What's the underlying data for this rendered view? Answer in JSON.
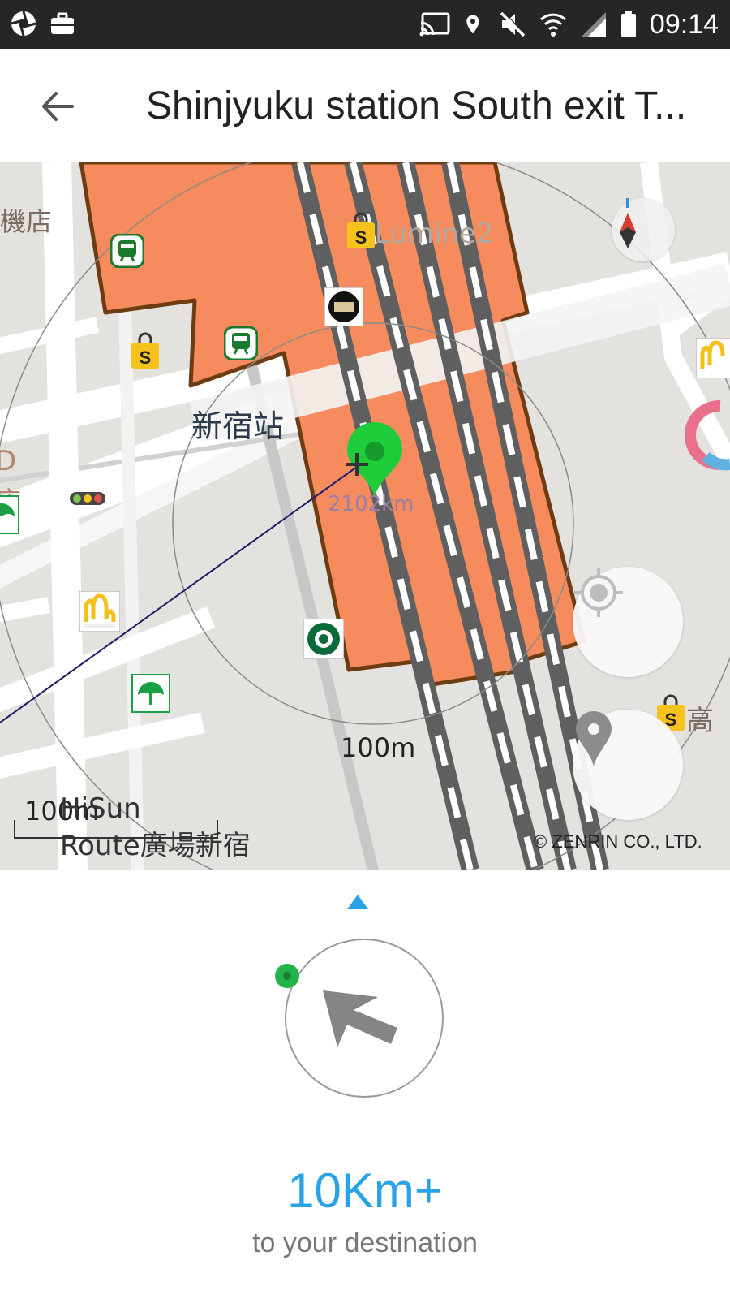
{
  "status_bar": {
    "time": "09:14",
    "icons_left": [
      "aperture-icon",
      "briefcase-icon"
    ],
    "icons_right": [
      "cast-icon",
      "location-pin-icon",
      "mute-icon",
      "wifi-icon",
      "signal-icon",
      "battery-icon"
    ]
  },
  "header": {
    "title": "Shinjyuku station South exit T...",
    "back_icon": "arrow-back-icon"
  },
  "map": {
    "labels": {
      "shop_left": "機店",
      "lumine": "Lumine2",
      "shinjuku_station": "新宿站",
      "distance_marker": "2102km",
      "circle_radius": "100m",
      "scale": "100m",
      "hotel_line1": "HiSun",
      "hotel_line2": "Route廣場新宿",
      "right_edge": "高",
      "left_edge_1": "D",
      "left_edge_2": "店"
    },
    "copyright": "© ZENRIN CO., LTD.",
    "controls": {
      "compass": "compass-icon",
      "my_location": "my-location-icon",
      "pin_button": "place-pin-icon"
    },
    "colors": {
      "station": "#f68c5d",
      "station_border": "#6e3c12",
      "rail": "#5f5f5f",
      "road": "#ffffff",
      "land": "#e3e2df",
      "marker": "#1fcc3a",
      "route_line": "#1c1c6b"
    }
  },
  "compass_panel": {
    "direction_indicator": "triangle-up-icon",
    "arrow": "direction-arrow-icon",
    "distance": "10Km+",
    "subtitle": "to your destination",
    "accent_color": "#29a3e8",
    "dot_color": "#22b34a"
  }
}
